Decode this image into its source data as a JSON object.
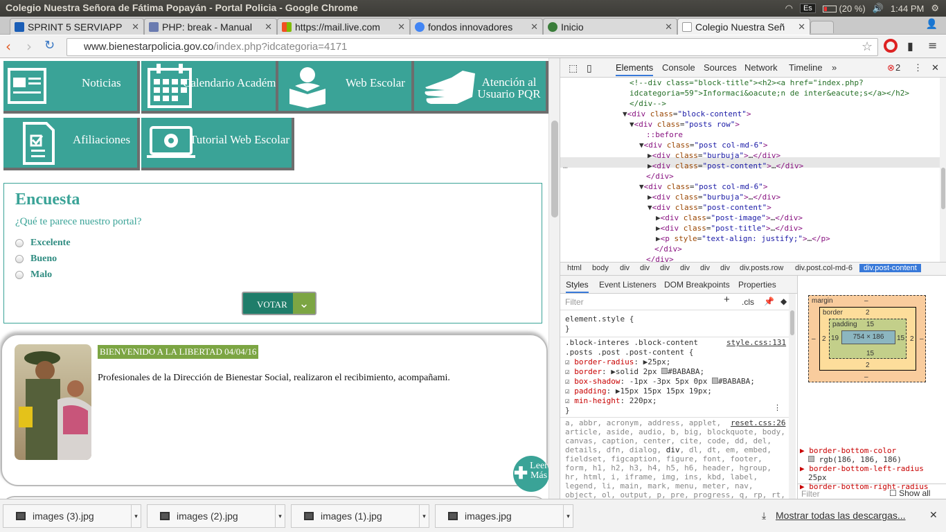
{
  "system": {
    "window_title": "Colegio Nuestra Señora de Fátima Popayán - Portal Policia - Google Chrome",
    "lang": "Es",
    "battery": "(20 %)",
    "time": "1:44 PM"
  },
  "tabs": [
    {
      "label": "SPRINT 5 SERVIAPP",
      "fav": "#1a5db6"
    },
    {
      "label": "PHP: break - Manual",
      "fav": "#6a7bb0"
    },
    {
      "label": "https://mail.live.com",
      "fav": "#e5462a"
    },
    {
      "label": "fondos innovadores",
      "fav": "#4285f4"
    },
    {
      "label": "Inicio",
      "fav": "#3a7d3a"
    },
    {
      "label": "Colegio Nuestra Señ",
      "fav": "#ffffff"
    }
  ],
  "address": {
    "host": "www.bienestarpolicia.gov.co",
    "path": "/index.php?idcategoria=4171"
  },
  "tiles": [
    "Noticias",
    "Calendario Académico",
    "Web Escolar",
    "Atención al Usuario PQR",
    "Afiliaciones",
    "Tutorial Web Escolar"
  ],
  "survey": {
    "title": "Encuesta",
    "question": "¿Qué te parece nuestro portal?",
    "options": [
      "Excelente",
      "Bueno",
      "Malo"
    ],
    "vote": "VOTAR"
  },
  "post": {
    "title": "BIENVENIDO A LA LIBERTAD 04/04/16",
    "text": "Profesionales de la Dirección de Bienestar Social, realizaron el recibimiento, acompañami.",
    "more": "Leer Más"
  },
  "devtools": {
    "tabs": [
      "Elements",
      "Console",
      "Sources",
      "Network",
      "Timeline"
    ],
    "errors": "2",
    "breadcrumbs": [
      "html",
      "body",
      "div",
      "div",
      "div",
      "div",
      "div",
      "div",
      "div.posts.row",
      "div.post.col-md-6",
      "div.post-content"
    ],
    "style_tabs": [
      "Styles",
      "Event Listeners",
      "DOM Breakpoints",
      "Properties"
    ],
    "filter": "Filter",
    "cls": ".cls",
    "box": {
      "margin": "margin",
      "border": "border",
      "padding": "padding",
      "content": "754 × 186",
      "dash": "–",
      "b2": "2",
      "p15": "15",
      "p19": "19"
    },
    "computed_filter": "Filter",
    "show_all": "Show all",
    "computed": [
      "border-bottom-color",
      "rgb(186, 186, 186)",
      "border-bottom-left-radius",
      "25px",
      "border-bottom-right-radius"
    ]
  },
  "downloads": {
    "items": [
      "images (3).jpg",
      "images (2).jpg",
      "images (1).jpg",
      "images.jpg"
    ],
    "show_all": "Mostrar todas las descargas..."
  }
}
